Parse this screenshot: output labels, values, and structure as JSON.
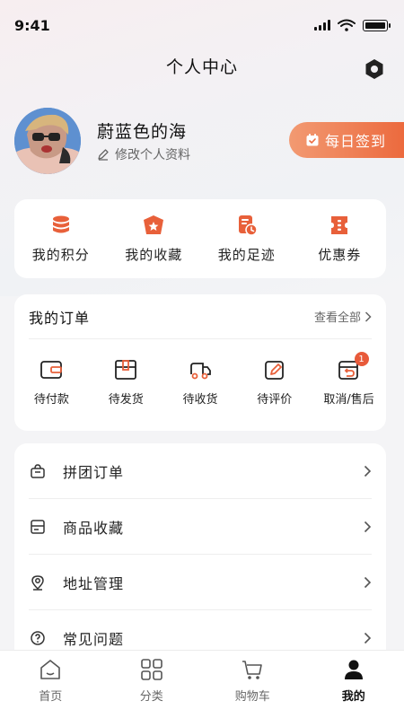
{
  "status_bar": {
    "time": "9:41"
  },
  "header": {
    "title": "个人中心",
    "settings_icon": "gear-icon"
  },
  "profile": {
    "username": "蔚蓝色的海",
    "edit_label": "修改个人资料",
    "checkin_label": "每日签到"
  },
  "quick_links": [
    {
      "label": "我的积分",
      "icon": "points-icon"
    },
    {
      "label": "我的收藏",
      "icon": "favorites-icon"
    },
    {
      "label": "我的足迹",
      "icon": "footprint-icon"
    },
    {
      "label": "优惠券",
      "icon": "coupon-icon"
    }
  ],
  "orders": {
    "title": "我的订单",
    "view_all": "查看全部",
    "items": [
      {
        "label": "待付款",
        "icon": "wallet-icon"
      },
      {
        "label": "待发货",
        "icon": "package-icon"
      },
      {
        "label": "待收货",
        "icon": "truck-icon"
      },
      {
        "label": "待评价",
        "icon": "edit-icon"
      },
      {
        "label": "取消/售后",
        "icon": "return-icon",
        "badge": "1"
      }
    ]
  },
  "menu": [
    {
      "label": "拼团订单",
      "icon": "bag-icon"
    },
    {
      "label": "商品收藏",
      "icon": "collection-icon"
    },
    {
      "label": "地址管理",
      "icon": "location-icon"
    },
    {
      "label": "常见问题",
      "icon": "question-icon"
    }
  ],
  "tabs": [
    {
      "label": "首页",
      "icon": "home-icon"
    },
    {
      "label": "分类",
      "icon": "category-icon"
    },
    {
      "label": "购物车",
      "icon": "cart-icon"
    },
    {
      "label": "我的",
      "icon": "user-icon",
      "active": true
    }
  ],
  "colors": {
    "accent": "#e8603a",
    "accent_light": "#f29a72",
    "badge": "#e85a3a"
  }
}
